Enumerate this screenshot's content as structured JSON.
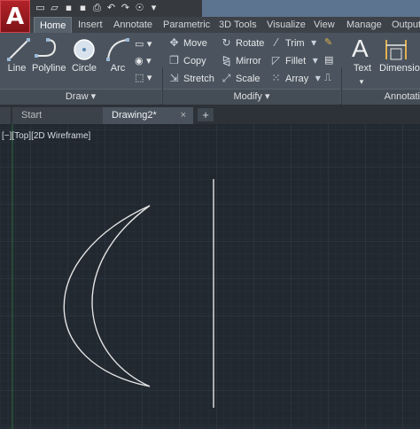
{
  "app": {
    "logo_letter": "A"
  },
  "ribbon_tabs": [
    "Home",
    "Insert",
    "Annotate",
    "Parametric",
    "3D Tools",
    "Visualize",
    "View",
    "Manage",
    "Output"
  ],
  "draw_panel": {
    "title": "Draw",
    "tools": [
      "Line",
      "Polyline",
      "Circle",
      "Arc"
    ]
  },
  "modify_panel": {
    "title": "Modify",
    "col1": [
      "Move",
      "Copy",
      "Stretch"
    ],
    "col2": [
      "Rotate",
      "Mirror",
      "Scale"
    ],
    "col3": [
      "Trim",
      "Fillet",
      "Array"
    ]
  },
  "annotation_panel": {
    "title": "Annotati",
    "tools": [
      "Text",
      "Dimension"
    ]
  },
  "doc_tabs": {
    "start": "Start",
    "active": "Drawing2*",
    "close": "×",
    "new": "+"
  },
  "viewport": {
    "label": "[−][Top][2D Wireframe]"
  },
  "colors": {
    "accent_red": "#b3242a",
    "canvas": "#212830",
    "ribbon": "#4b545e"
  }
}
